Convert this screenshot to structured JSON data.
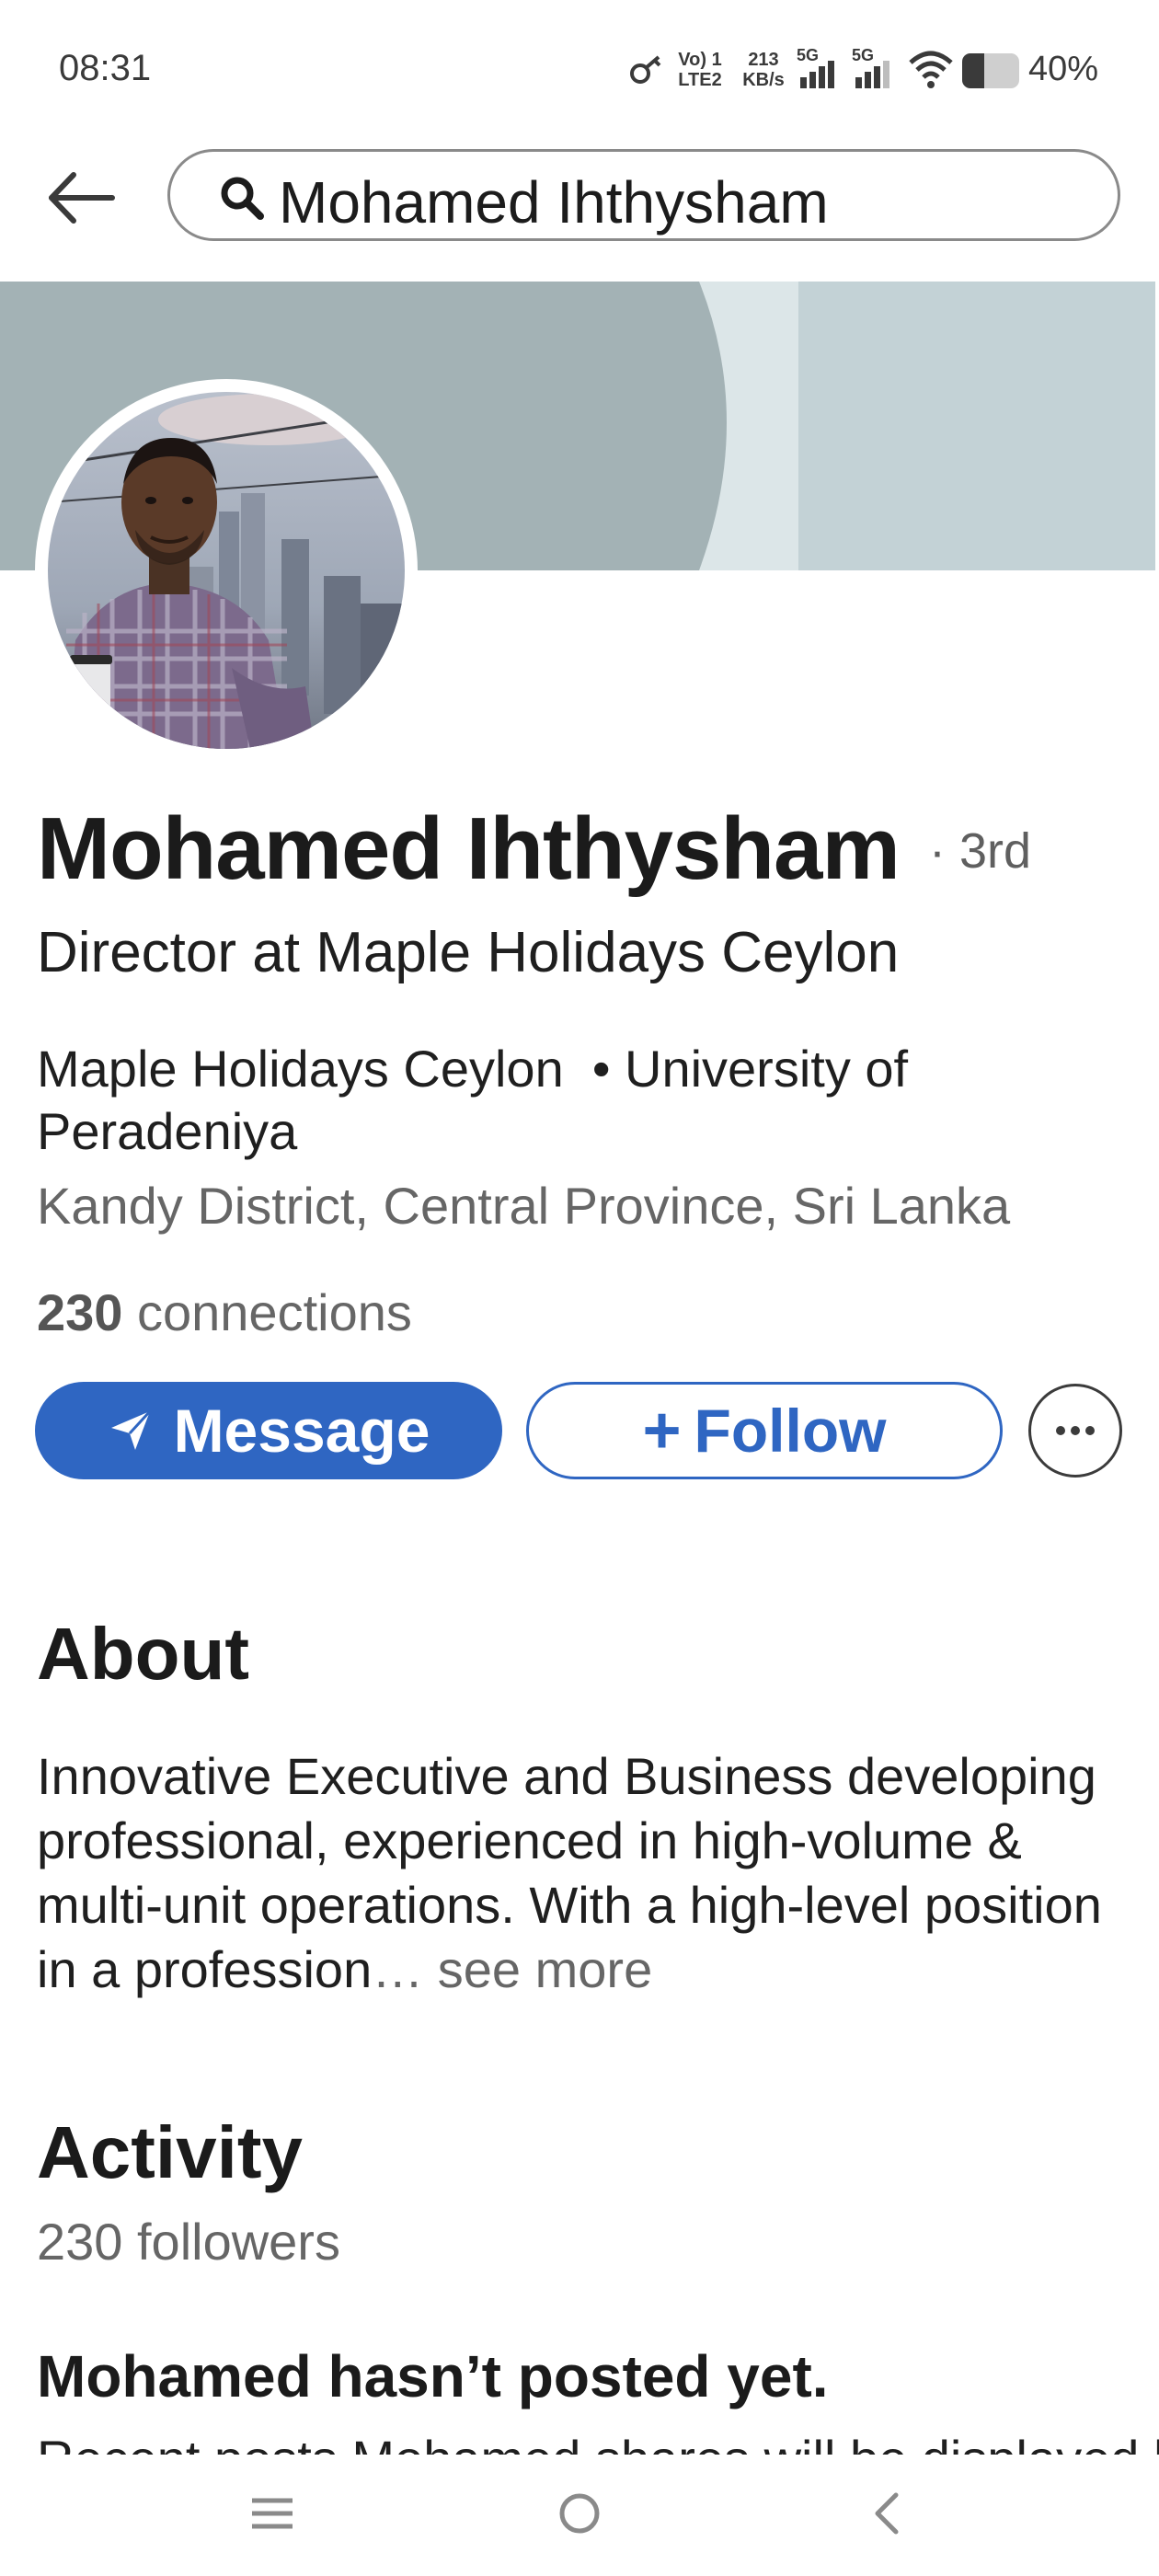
{
  "status_bar": {
    "time": "08:31",
    "volte_top": "Vo) 1",
    "volte_bottom": "LTE2",
    "speed_top": "213",
    "speed_bottom": "KB/s",
    "net1": "5G",
    "net2": "5G",
    "battery_percent": "40%"
  },
  "search": {
    "query": "Mohamed Ihthysham"
  },
  "profile": {
    "name": "Mohamed Ihthysham",
    "degree": "· 3rd",
    "headline": "Director at Maple Holidays Ceylon",
    "company": "Maple Holidays Ceylon",
    "education_prefix": "• University of",
    "education_rest": "Peradeniya",
    "location": "Kandy District, Central Province, Sri Lanka",
    "connections_count": "230",
    "connections_label": "connections"
  },
  "actions": {
    "message_label": "Message",
    "follow_label": "Follow",
    "follow_prefix": "+"
  },
  "about": {
    "title": "About",
    "text": "Innovative Executive and Business developing professional, experienced in high-volume & multi-unit operations.  With a high-level position in a profession",
    "see_more": "… see more"
  },
  "activity": {
    "title": "Activity",
    "followers": "230 followers",
    "no_posts_title": "Mohamed hasn’t posted yet.",
    "no_posts_desc": "Recent posts Mohamed shares will be displayed here."
  },
  "colors": {
    "accent": "#2f66c2",
    "banner": "#a3b2b5"
  },
  "icons": [
    "back-arrow-icon",
    "search-icon",
    "send-icon",
    "more-icon",
    "menu-icon",
    "home-icon",
    "back-nav-icon",
    "wifi-icon",
    "battery-icon",
    "signal-icon"
  ]
}
